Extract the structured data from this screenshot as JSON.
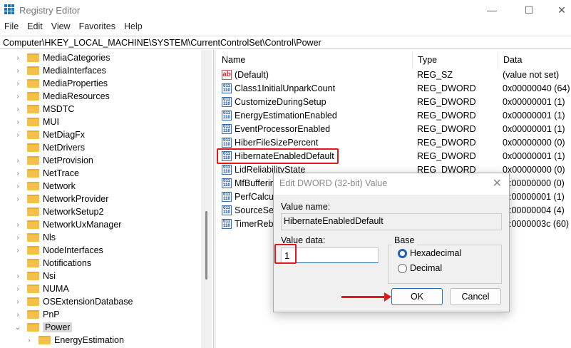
{
  "window": {
    "title": "Registry Editor",
    "minimize": "—",
    "maximize": "☐",
    "close": "✕"
  },
  "menu": [
    "File",
    "Edit",
    "View",
    "Favorites",
    "Help"
  ],
  "address": "Computer\\HKEY_LOCAL_MACHINE\\SYSTEM\\CurrentControlSet\\Control\\Power",
  "tree": [
    {
      "label": "MediaCategories",
      "chev": "›"
    },
    {
      "label": "MediaInterfaces",
      "chev": "›"
    },
    {
      "label": "MediaProperties",
      "chev": "›"
    },
    {
      "label": "MediaResources",
      "chev": "›"
    },
    {
      "label": "MSDTC",
      "chev": "›"
    },
    {
      "label": "MUI",
      "chev": "›"
    },
    {
      "label": "NetDiagFx",
      "chev": "›"
    },
    {
      "label": "NetDrivers",
      "chev": ""
    },
    {
      "label": "NetProvision",
      "chev": "›"
    },
    {
      "label": "NetTrace",
      "chev": "›"
    },
    {
      "label": "Network",
      "chev": "›"
    },
    {
      "label": "NetworkProvider",
      "chev": "›"
    },
    {
      "label": "NetworkSetup2",
      "chev": ""
    },
    {
      "label": "NetworkUxManager",
      "chev": "›"
    },
    {
      "label": "Nls",
      "chev": "›"
    },
    {
      "label": "NodeInterfaces",
      "chev": "›"
    },
    {
      "label": "Notifications",
      "chev": ""
    },
    {
      "label": "Nsi",
      "chev": "›"
    },
    {
      "label": "NUMA",
      "chev": "›"
    },
    {
      "label": "OSExtensionDatabase",
      "chev": "›"
    },
    {
      "label": "PnP",
      "chev": "›"
    },
    {
      "label": "Power",
      "chev": "⌄",
      "selected": true
    },
    {
      "label": "EnergyEstimation",
      "chev": "›",
      "child": true
    }
  ],
  "list": {
    "headers": [
      "Name",
      "Type",
      "Data"
    ],
    "rows": [
      {
        "name": "(Default)",
        "type": "REG_SZ",
        "data": "(value not set)",
        "icon": "ab"
      },
      {
        "name": "Class1InitialUnparkCount",
        "type": "REG_DWORD",
        "data": "0x00000040 (64)"
      },
      {
        "name": "CustomizeDuringSetup",
        "type": "REG_DWORD",
        "data": "0x00000001 (1)"
      },
      {
        "name": "EnergyEstimationEnabled",
        "type": "REG_DWORD",
        "data": "0x00000001 (1)"
      },
      {
        "name": "EventProcessorEnabled",
        "type": "REG_DWORD",
        "data": "0x00000001 (1)"
      },
      {
        "name": "HiberFileSizePercent",
        "type": "REG_DWORD",
        "data": "0x00000000 (0)"
      },
      {
        "name": "HibernateEnabledDefault",
        "type": "REG_DWORD",
        "data": "0x00000001 (1)"
      },
      {
        "name": "LidReliabilityState",
        "type": "REG_DWORD",
        "data": "0x00000000 (0)"
      },
      {
        "name": "MfBufferin",
        "type": "",
        "data": ":00000000 (0)"
      },
      {
        "name": "PerfCalcul",
        "type": "",
        "data": ":00000001 (1)"
      },
      {
        "name": "SourceSett",
        "type": "",
        "data": ":00000004 (4)"
      },
      {
        "name": "TimerReba",
        "type": "",
        "data": ":0000003c (60)"
      }
    ]
  },
  "dialog": {
    "title": "Edit DWORD (32-bit) Value",
    "close": "✕",
    "value_name_label": "Value name:",
    "value_name": "HibernateEnabledDefault",
    "value_data_label": "Value data:",
    "value_data": "1",
    "base_label": "Base",
    "hex": "Hexadecimal",
    "dec": "Decimal",
    "ok": "OK",
    "cancel": "Cancel"
  },
  "colors": {
    "highlight": "#e0181b",
    "accent": "#1f62b8"
  }
}
